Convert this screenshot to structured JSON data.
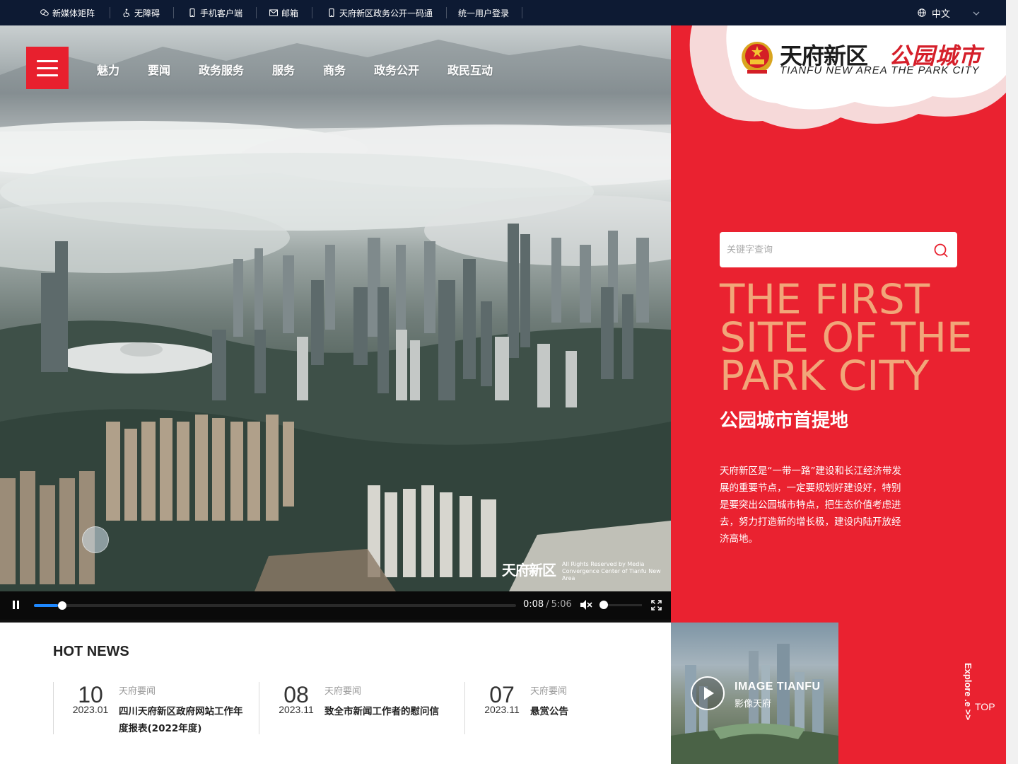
{
  "topbar": {
    "items": [
      {
        "label": "新媒体矩阵",
        "icon": "wechat-icon"
      },
      {
        "label": "无障碍",
        "icon": "accessibility-icon"
      },
      {
        "label": "手机客户端",
        "icon": "mobile-icon"
      },
      {
        "label": "邮箱",
        "icon": "mail-icon"
      },
      {
        "label": "天府新区政务公开一码通",
        "icon": "mobile-icon"
      },
      {
        "label": "统一用户登录",
        "icon": ""
      }
    ],
    "language": "中文"
  },
  "nav": {
    "items": [
      "魅力",
      "要闻",
      "政务服务",
      "服务",
      "商务",
      "政务公开",
      "政民互动"
    ]
  },
  "video": {
    "current_time": "0:08",
    "separator": "/",
    "duration": "5:06",
    "progress": 0.026,
    "volume": 0,
    "muted": true,
    "watermark_brand": "天府新区",
    "watermark_text": "All Rights Reserved by Media Convergence Center of Tianfu New Area"
  },
  "header": {
    "logo_cn_black": "天府新区",
    "logo_cn_red": "公园城市",
    "logo_en": "TIANFU NEW AREA THE PARK CITY"
  },
  "search": {
    "placeholder": "关键字查询",
    "value": ""
  },
  "hero_text": {
    "slogan_line1": "THE FIRST",
    "slogan_line2": "SITE OF THE",
    "slogan_line3": "PARK CITY",
    "slogan_cn": "公园城市首提地",
    "intro": "天府新区是“一带一路”建设和长江经济带发展的重要节点，一定要规划好建设好，特别是要突出公园城市特点，把生态价值考虑进去，努力打造新的增长极，建设内陆开放经济高地。"
  },
  "hot_news": {
    "title": "HOT NEWS",
    "items": [
      {
        "day": "10",
        "ym": "2023.01",
        "category": "天府要闻",
        "title": "四川天府新区政府网站工作年度报表(2022年度)"
      },
      {
        "day": "08",
        "ym": "2023.11",
        "category": "天府要闻",
        "title": "致全市新闻工作者的慰问信"
      },
      {
        "day": "07",
        "ym": "2023.11",
        "category": "天府要闻",
        "title": "悬赏公告"
      }
    ]
  },
  "image_card": {
    "title_en": "IMAGE TIANFU",
    "title_cn": "影像天府"
  },
  "side": {
    "explore": "Explore .e >>",
    "top": "TOP"
  },
  "colors": {
    "brand_red": "#ea2230",
    "slogan_orange": "#f1a679",
    "topbar_navy": "#0d1a33",
    "progress_blue": "#1e88ff"
  }
}
